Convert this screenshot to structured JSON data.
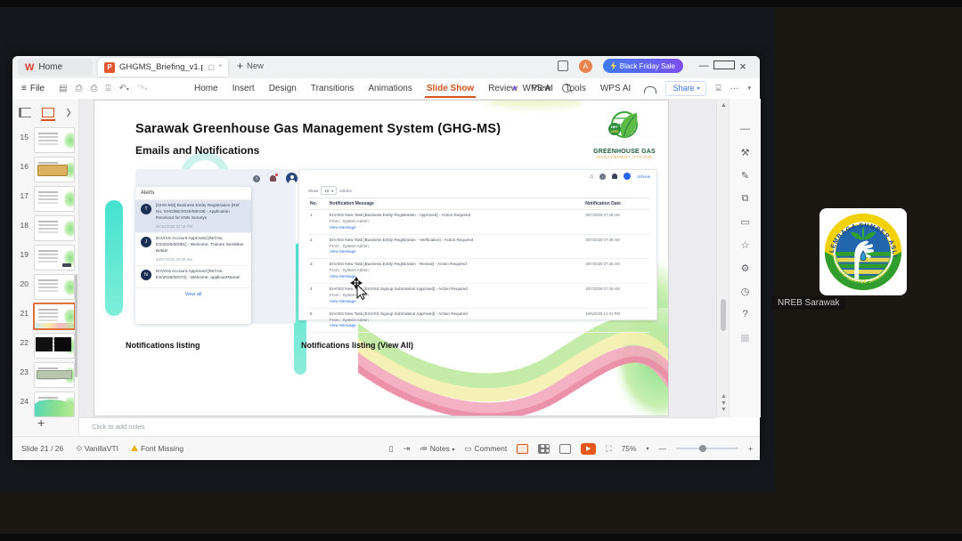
{
  "meeting": {
    "participant_name": "NREB Sarawak",
    "logo": {
      "top_text": "LEMBAGA SUMBER ASLI",
      "bottom_text": "DAN ALAM SEKITAR SARAWAK"
    }
  },
  "window": {
    "tabs": {
      "home_label": "Home",
      "doc_title": "GHGMS_Briefing_v1.pptx",
      "modified_indicator": "*",
      "new_label": "New"
    },
    "titlebar": {
      "promo_label": "Black Friday Sale",
      "avatar_letter": "A"
    },
    "file_label": "File",
    "menus": [
      {
        "label": "Home"
      },
      {
        "label": "Insert"
      },
      {
        "label": "Design"
      },
      {
        "label": "Transitions"
      },
      {
        "label": "Animations"
      },
      {
        "label": "Slide Show",
        "active": true
      },
      {
        "label": "Review"
      },
      {
        "label": "View"
      },
      {
        "label": "Tools"
      },
      {
        "label": "WPS AI"
      }
    ],
    "share_label": "Share"
  },
  "thumbnails": {
    "items": [
      {
        "num": "15",
        "variant": "list"
      },
      {
        "num": "16",
        "variant": "orange"
      },
      {
        "num": "17",
        "variant": "list"
      },
      {
        "num": "18",
        "variant": "plain"
      },
      {
        "num": "19",
        "variant": "form"
      },
      {
        "num": "20",
        "variant": "plain"
      },
      {
        "num": "21",
        "variant": "tables",
        "current": true
      },
      {
        "num": "22",
        "variant": "dark"
      },
      {
        "num": "23",
        "variant": "banner"
      },
      {
        "num": "24",
        "variant": "wave"
      }
    ],
    "add_label": "+"
  },
  "slide": {
    "title": "Sarawak Greenhouse Gas Management System (GHG-MS)",
    "subtitle": "Emails and Notifications",
    "logo": {
      "line1": "GREENHOUSE GAS",
      "line2": "MANAGEMENT SYSTEM",
      "badge": "NET 2050"
    },
    "alerts_panel": {
      "header": "Alerts",
      "items": [
        {
          "avatar": "T",
          "text": "[GHG-MS] Business Entity Registration [Ref No. GHG/BE/2025/00018] - Application Received for KNN Surveys",
          "date": "21/10/2025 02:19 PM",
          "highlight": true
        },
        {
          "avatar": "J",
          "text": "EnVISS Account Approved [Ref No. ES/2025/00081] - Welcome, Trainee Sembilan Belas!",
          "date": "30/07/2025 09:09 AM"
        },
        {
          "avatar": "N",
          "text": "EnVISS Account Approved [Ref No. ES/2025/00072] - Welcome, applicantName!",
          "date": ""
        }
      ],
      "view_all": "View all"
    },
    "table_panel": {
      "user_label": "Johnnie",
      "show_label": "Show",
      "page_size": "10",
      "entries_label": "entries",
      "columns": {
        "no": "No.",
        "message": "Notification Message",
        "date": "Notification Date"
      },
      "from_label": "From : System Admin",
      "view_label": "View Message",
      "rows": [
        {
          "no": "1",
          "message": "EnVISS New Task [Business Entity Registration - Approved] - Action Required",
          "date": "30/7/2025 07:49 AM"
        },
        {
          "no": "2",
          "message": "EnVISS New Task [Business Entity Registration - Verification] - Action Required",
          "date": "30/7/2025 07:49 AM"
        },
        {
          "no": "3",
          "message": "EnVISS New Task [Business Entity Registration - Review] - Action Required",
          "date": "30/7/2025 07:46 AM"
        },
        {
          "no": "4",
          "message": "EnVISS New Task [EnVISS Signup Submission Approved] - Action Required",
          "date": "30/7/2025 07:30 AM"
        },
        {
          "no": "5",
          "message": "EnVISS New Task [EnVISS Signup Submission Approved] - Action Required",
          "date": "16/6/2025 12:41 PM"
        }
      ]
    },
    "captions": {
      "left": "Notifications listing",
      "right": "Notifications listing (View All)"
    }
  },
  "notes_placeholder": "Click to add notes",
  "right_sidebar_icons": [
    {
      "name": "collapse-icon",
      "glyph": "—"
    },
    {
      "name": "tools-icon",
      "glyph": "⚒"
    },
    {
      "name": "edit-icon",
      "glyph": "✎"
    },
    {
      "name": "shapes-icon",
      "glyph": "⧉"
    },
    {
      "name": "comment-icon",
      "glyph": "▭"
    },
    {
      "name": "favorites-icon",
      "glyph": "☆"
    },
    {
      "name": "settings-icon",
      "glyph": "⚙"
    },
    {
      "name": "history-icon",
      "glyph": "◷"
    },
    {
      "name": "help-icon",
      "glyph": "?"
    },
    {
      "name": "apps-icon",
      "glyph": "▦",
      "dim": true
    }
  ],
  "statusbar": {
    "slide_indicator": "Slide 21 / 26",
    "theme_name": "VanillaVTI",
    "font_missing": "Font Missing",
    "notes_label": "Notes",
    "comment_label": "Comment",
    "zoom_level": "75%"
  },
  "colors": {
    "accent_orange": "#d2541e",
    "promo_gradient_start": "#3f7bf5",
    "promo_gradient_end": "#7b4ff0",
    "link_blue": "#2f6fe4",
    "teal_decoration": "#49e3cf",
    "logo_green": "#1e5b3c",
    "logo_orange": "#e8a33d"
  }
}
